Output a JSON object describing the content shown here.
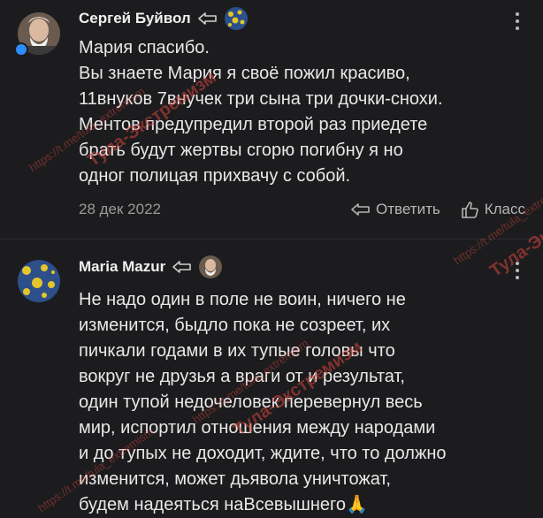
{
  "comments": [
    {
      "author": "Сергей Буйвол",
      "text": "Мария спасибо.\nВы знаете Мария я своё пожил красиво,\n11внуков 7внучек три сына три дочки-снохи.\nМентов предупредил второй раз приедете\nбрать будут жертвы сгорю погибну я но\nодног полицая прихвачу с собой.",
      "date": "28 дек 2022",
      "reply_label": "Ответить",
      "like_label": "Класс"
    },
    {
      "author": "Maria Mazur",
      "text": "Не надо один в поле не воин, ничего не\nизменится, быдло пока не созреет, их\nпичкали годами в их тупые головы что\nвокруг не друзья а враги от и результат,\nодин тупой недочеловек перевернул весь\nмир, испортил отношения между народами\nи до тупых не доходит, ждите, что то должно\nизменится, может дьявола уничтожат,\nбудем надеяться наВсевышнего🙏"
    }
  ],
  "watermark": {
    "text": "Тула-Экстремизм",
    "url_text": "https://t.me/tula_extremism"
  },
  "colors": {
    "background": "#1c1c1e",
    "online_indicator": "#2d8cff",
    "watermark": "#d2463c"
  }
}
